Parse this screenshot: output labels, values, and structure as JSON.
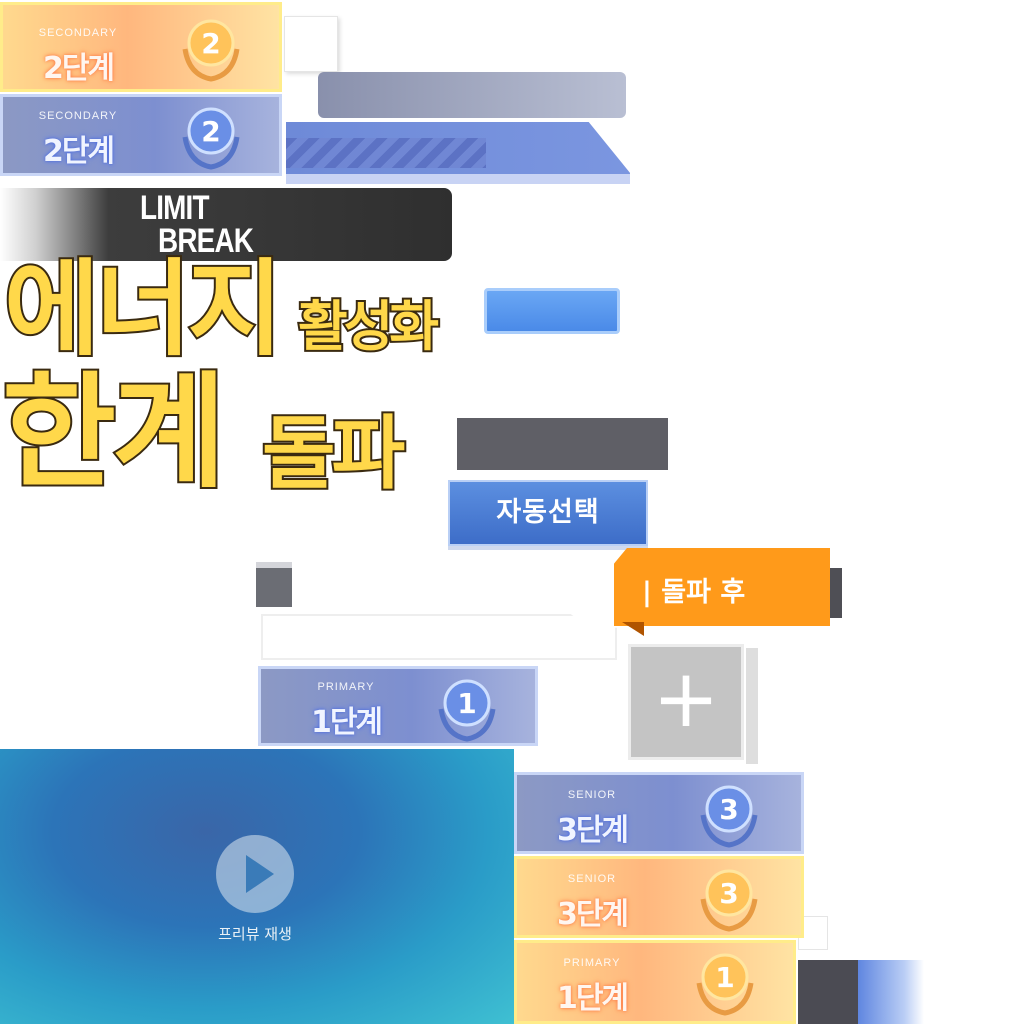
{
  "badges": [
    {
      "id": "secondary-gold",
      "eng": "SECONDARY",
      "kor": "2단계",
      "num": "2",
      "style": "gold"
    },
    {
      "id": "secondary-blue",
      "eng": "SECONDARY",
      "kor": "2단계",
      "num": "2",
      "style": "blue"
    },
    {
      "id": "primary-blue",
      "eng": "PRIMARY",
      "kor": "1단계",
      "num": "1",
      "style": "blue"
    },
    {
      "id": "senior-blue",
      "eng": "SENIOR",
      "kor": "3단계",
      "num": "3",
      "style": "blue"
    },
    {
      "id": "senior-gold",
      "eng": "SENIOR",
      "kor": "3단계",
      "num": "3",
      "style": "gold"
    },
    {
      "id": "primary-gold",
      "eng": "PRIMARY",
      "kor": "1단계",
      "num": "1",
      "style": "gold"
    }
  ],
  "limit_break": {
    "line1": "LIMIT",
    "line2": "BREAK"
  },
  "titles": {
    "energy": "에너지",
    "activation": "활성화",
    "limit": "한계",
    "breakthrough": "돌파"
  },
  "buttons": {
    "auto_select": "자동선택"
  },
  "tag": {
    "after_break": "| 돌파 후"
  },
  "plus": {
    "label": "+"
  },
  "video": {
    "caption": "프리뷰 재생",
    "icon": "play-icon"
  },
  "colors": {
    "gold_title": "#ffd84a",
    "orange_tag": "#ff9a1a",
    "blue_button": "#4a7ed6"
  }
}
